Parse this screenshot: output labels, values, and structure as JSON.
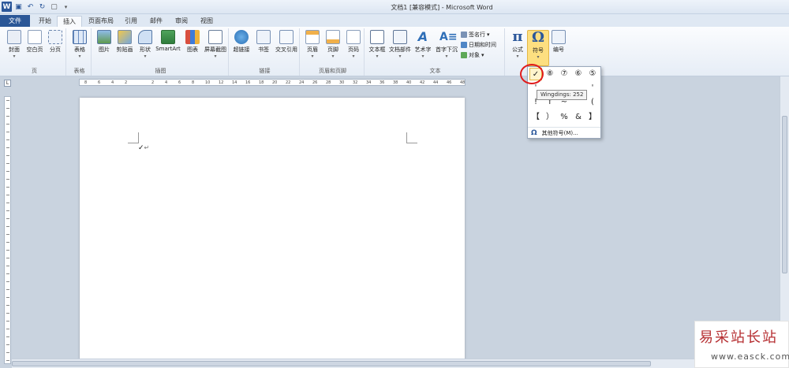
{
  "window": {
    "title": "文档1 [兼容模式] - Microsoft Word"
  },
  "tabs": [
    {
      "label": "文件"
    },
    {
      "label": "开始"
    },
    {
      "label": "插入"
    },
    {
      "label": "页面布局"
    },
    {
      "label": "引用"
    },
    {
      "label": "邮件"
    },
    {
      "label": "审阅"
    },
    {
      "label": "视图"
    }
  ],
  "ribbon": {
    "groups": [
      {
        "label": "页"
      },
      {
        "label": "表格"
      },
      {
        "label": "插图"
      },
      {
        "label": "链接"
      },
      {
        "label": "页眉和页脚"
      },
      {
        "label": "文本"
      }
    ],
    "buttons": {
      "cover": "封面",
      "blank_page": "空白页",
      "page_break": "分页",
      "table": "表格",
      "picture": "图片",
      "clipart": "剪贴画",
      "shapes": "形状",
      "smartart": "SmartArt",
      "chart": "图表",
      "screenshot": "屏幕截图",
      "hyperlink": "超链接",
      "bookmark": "书签",
      "cross_ref": "交叉引用",
      "header": "页眉",
      "footer": "页脚",
      "page_number": "页码",
      "textbox": "文本框",
      "quick_parts": "文档部件",
      "wordart": "艺术字",
      "drop_cap": "首字下沉",
      "signature_line": "签名行",
      "date_time": "日期和时间",
      "object": "对象",
      "equation": "公式",
      "symbol": "符号",
      "number": "编号"
    }
  },
  "ruler": {
    "ticks": [
      "8",
      "6",
      "4",
      "2",
      "",
      "2",
      "4",
      "6",
      "8",
      "10",
      "12",
      "14",
      "16",
      "18",
      "20",
      "22",
      "24",
      "26",
      "28",
      "30",
      "32",
      "34",
      "36",
      "38",
      "40",
      "42",
      "44",
      "46",
      "48"
    ]
  },
  "document": {
    "text": "✓",
    "paragraph_mark": "↵"
  },
  "symbol_panel": {
    "symbols": [
      "✓",
      "⑧",
      "⑦",
      "⑥",
      "⑤",
      "'",
      "'",
      "'",
      "'",
      "'",
      "!",
      "f",
      "~",
      "'",
      "(",
      "【",
      "）",
      "%",
      "&",
      "】"
    ],
    "tooltip": "Wingdings: 252",
    "more_symbols": "其他符号(M)...",
    "more_icon": "Ω"
  },
  "watermark": {
    "cn": "易采站长站",
    "url": "www.easck.com"
  },
  "colors": {
    "file_tab": "#2b5797",
    "highlight_ring": "#e01b1b",
    "symbol_active": "#fddf80"
  }
}
